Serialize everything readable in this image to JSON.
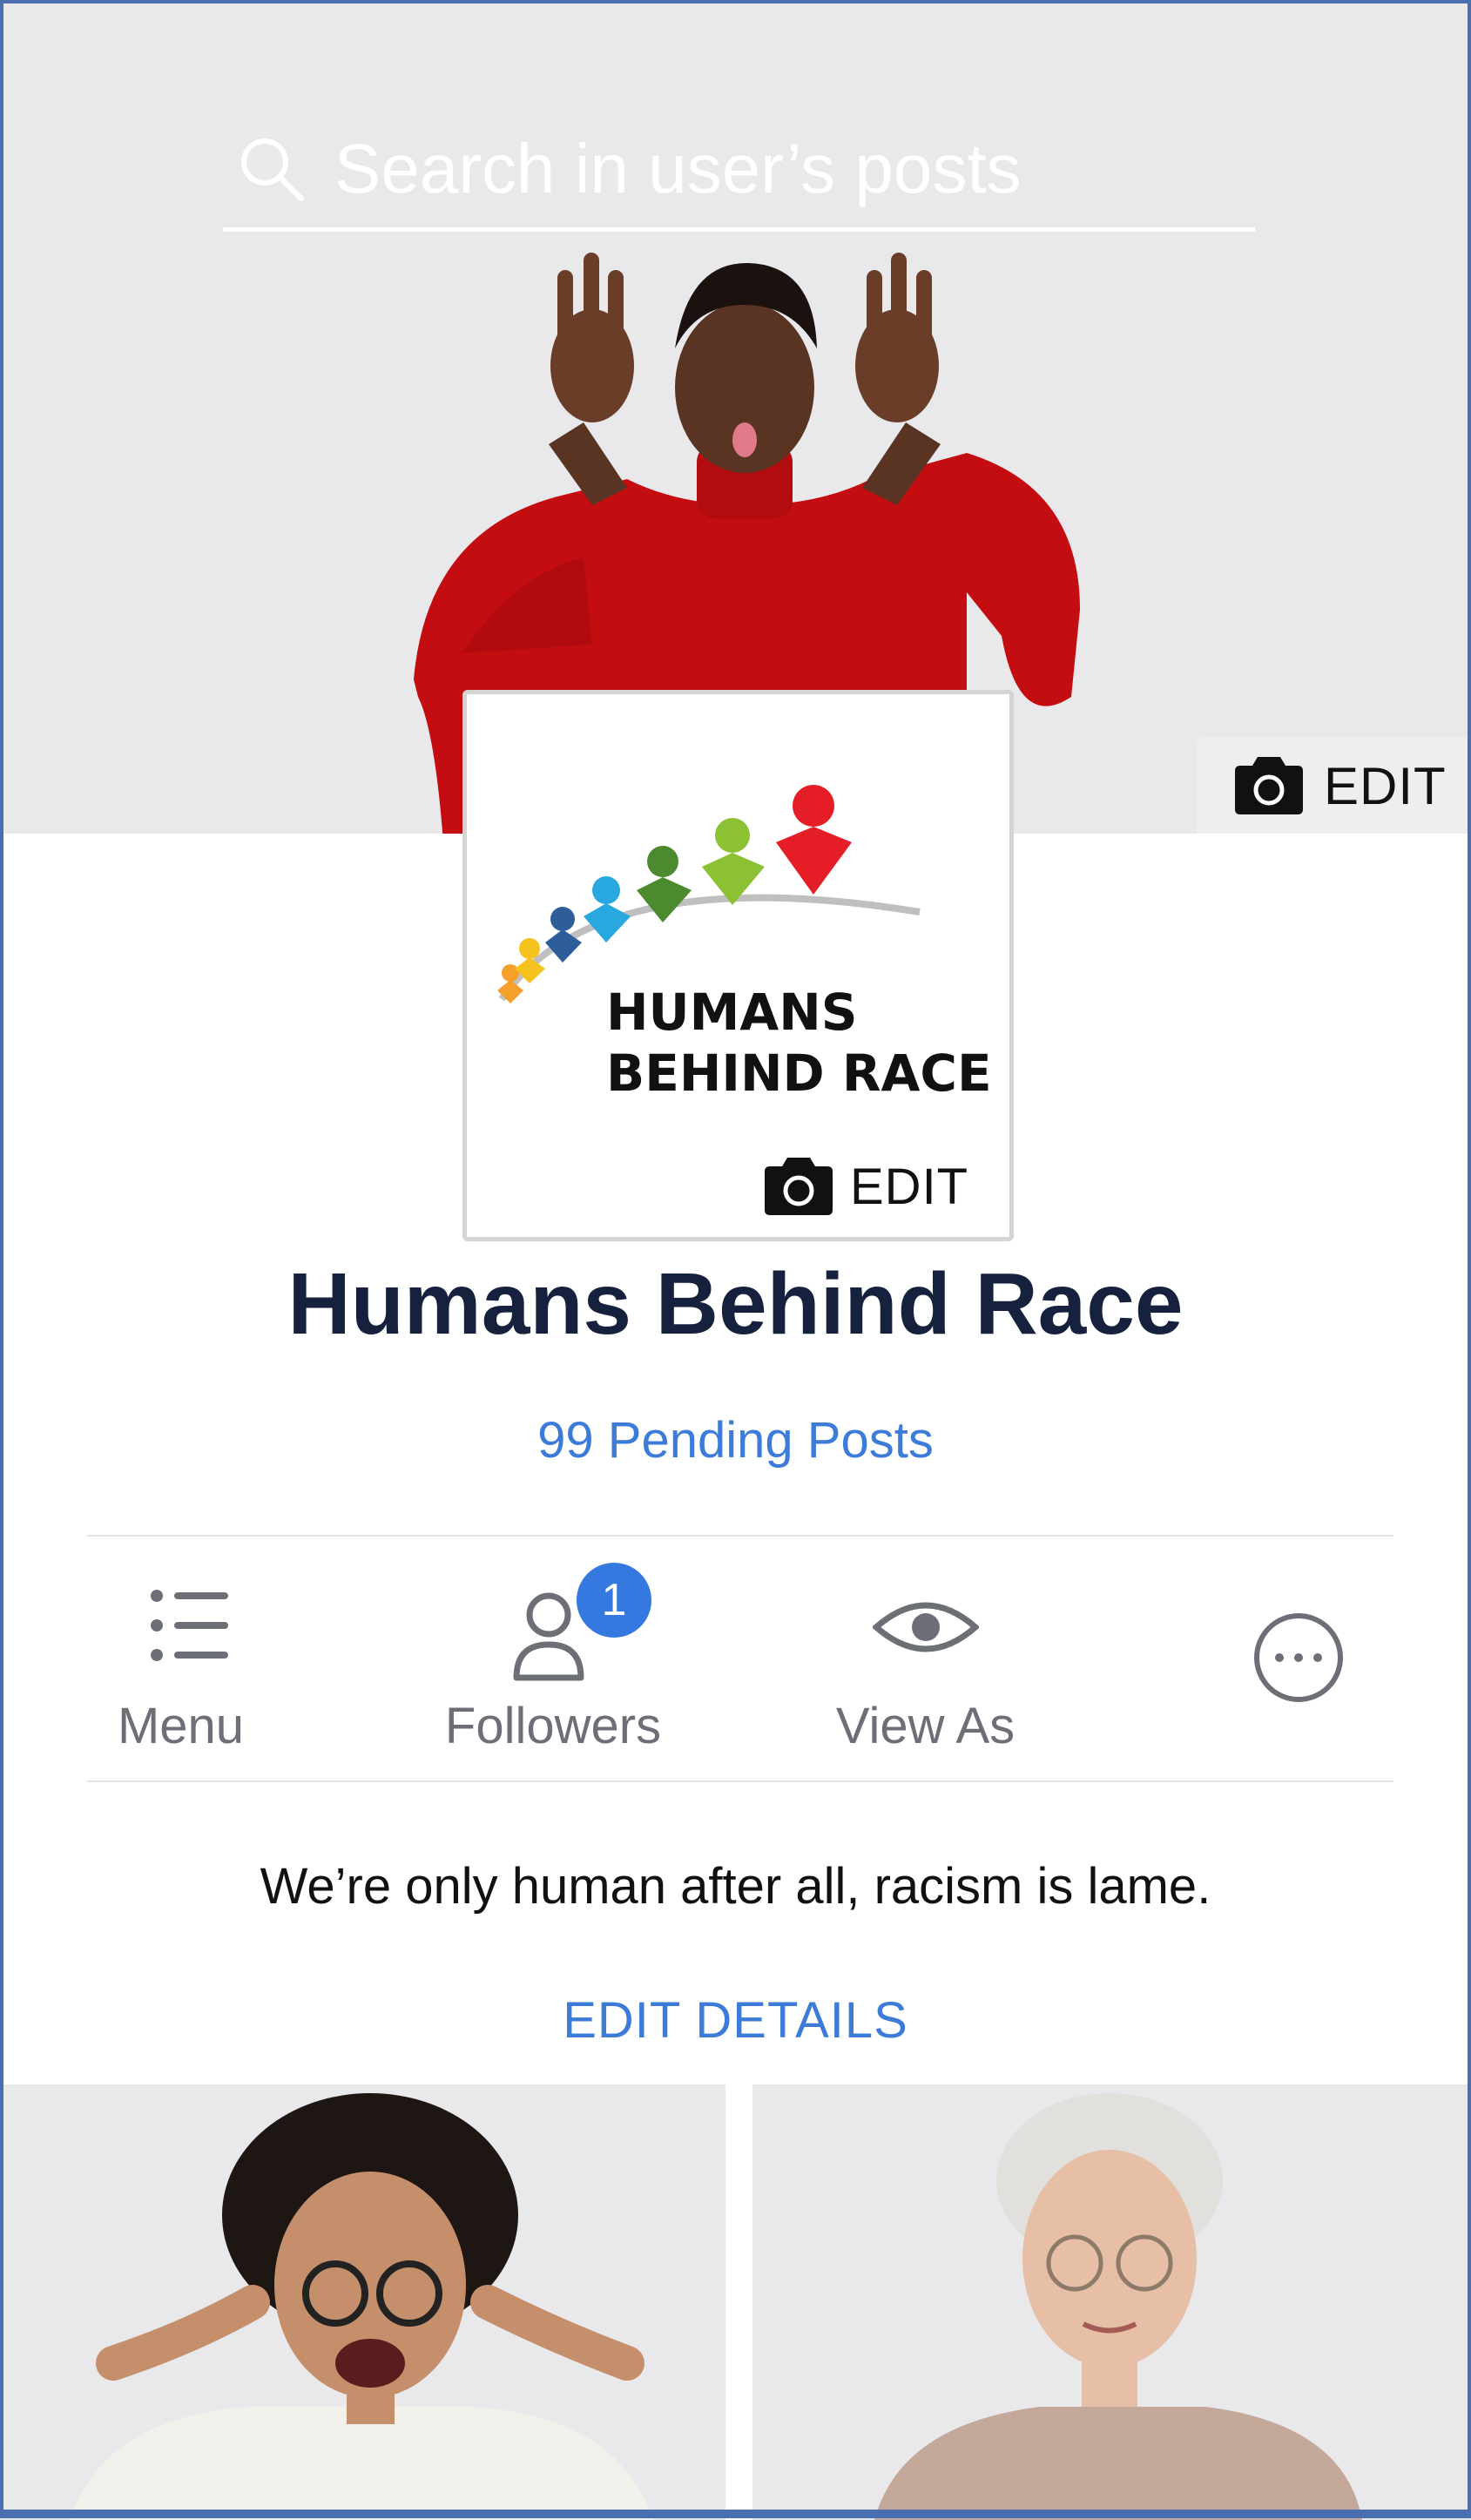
{
  "search": {
    "placeholder": "Search in user’s posts"
  },
  "cover": {
    "edit_label": "EDIT"
  },
  "profile": {
    "logo_line1": "HUMANS",
    "logo_line2": "BEHIND RACE",
    "edit_label": "EDIT"
  },
  "page": {
    "name": "Humans Behind Race",
    "pending_posts": "99 Pending Posts"
  },
  "actions": {
    "menu_label": "Menu",
    "followers_label": "Followers",
    "followers_badge": "1",
    "view_as_label": "View As"
  },
  "about": {
    "description": "We’re only human after all, racism is lame.",
    "edit_details_label": "EDIT DETAILS"
  },
  "colors": {
    "accent": "#3d7bd8",
    "badge": "#3478e0",
    "title": "#16213d",
    "cover_bg": "#e9e9ec"
  }
}
